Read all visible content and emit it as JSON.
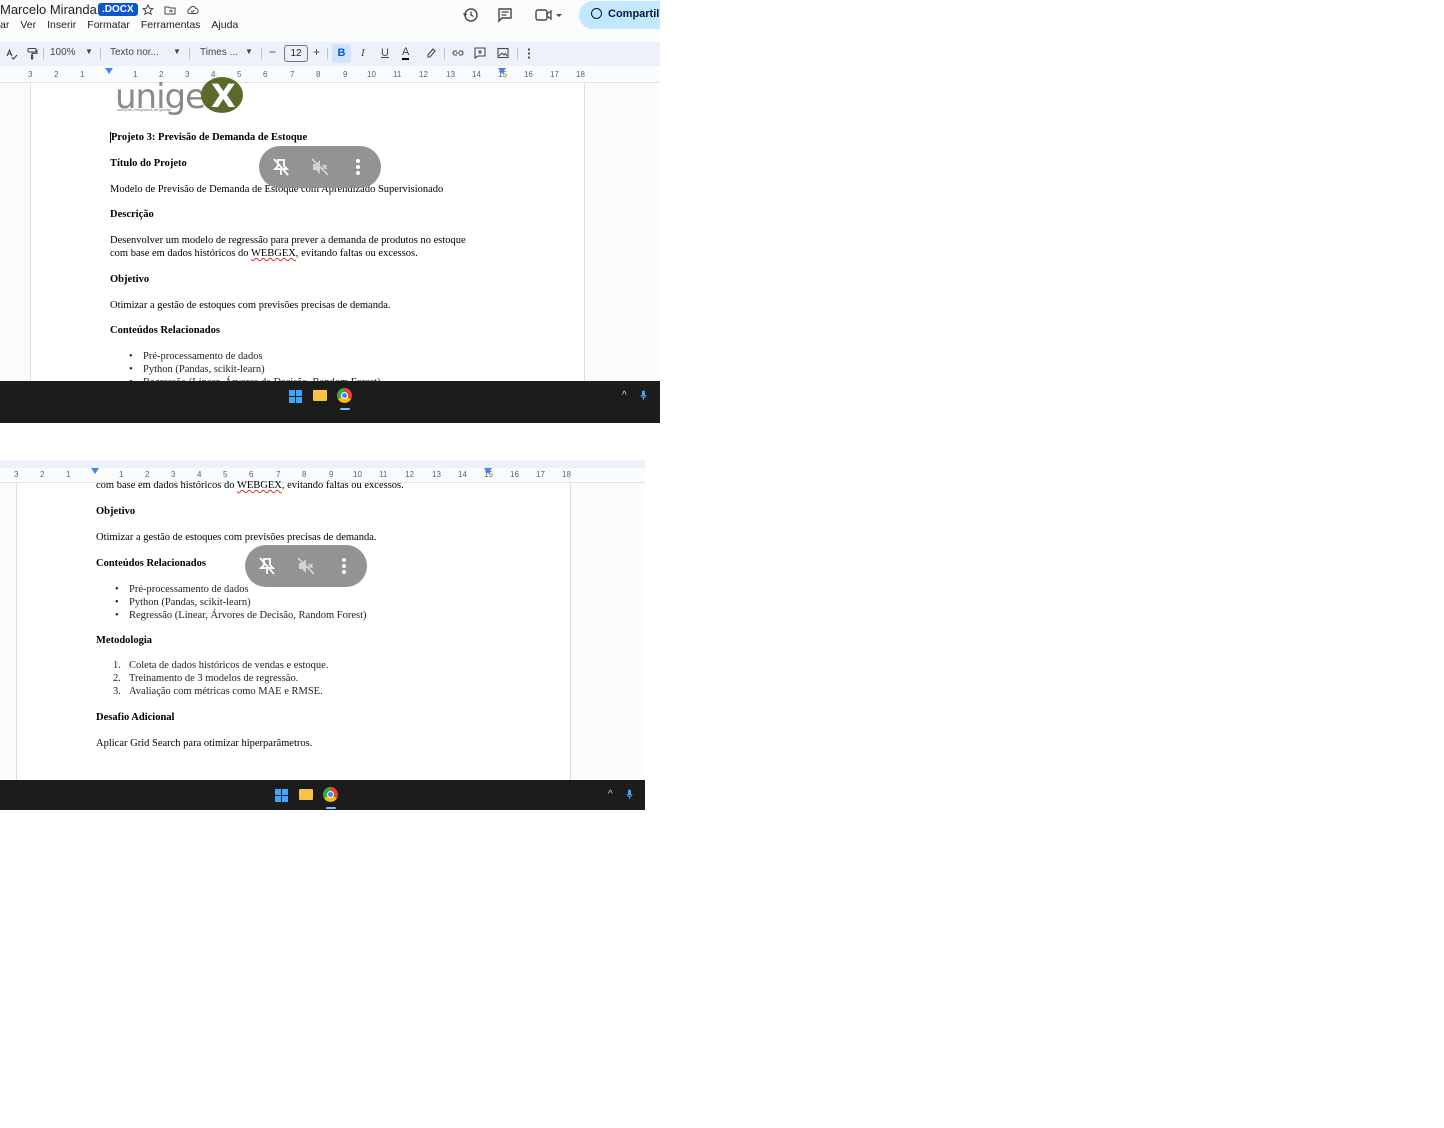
{
  "header": {
    "doc_title": "Marcelo Miranda",
    "badge": ".DOCX",
    "menu": [
      "ar",
      "Ver",
      "Inserir",
      "Formatar",
      "Ferramentas",
      "Ajuda"
    ],
    "share_label": "Compartilh"
  },
  "toolbar": {
    "zoom": "100%",
    "style": "Texto nor...",
    "font": "Times ...",
    "font_size": "12",
    "bold": "B",
    "italic": "I",
    "underline": "U",
    "text_color": "A",
    "minus": "−",
    "plus": "+"
  },
  "ruler": {
    "top": [
      "3",
      "2",
      "1",
      "1",
      "2",
      "3",
      "4",
      "5",
      "6",
      "7",
      "8",
      "9",
      "10",
      "11",
      "12",
      "13",
      "14",
      "15",
      "16",
      "17",
      "18"
    ],
    "bottom": [
      "3",
      "2",
      "1",
      "1",
      "2",
      "3",
      "4",
      "5",
      "6",
      "7",
      "8",
      "9",
      "10",
      "11",
      "12",
      "13",
      "14",
      "15",
      "16",
      "17",
      "18"
    ]
  },
  "logo": {
    "word": "unige",
    "x": "X",
    "tagline": "soluções integradas de gestão"
  },
  "doc": {
    "project_title": "Projeto 3: Previsão de Demanda de Estoque",
    "h_titulo": "Título do Projeto",
    "titulo": "Modelo de Previsão de Demanda de Estoque com Aprendizado Supervisionado",
    "h_descricao": "Descrição",
    "descricao_1": "Desenvolver um modelo de regressão para prever a demanda de produtos no estoque",
    "descricao_2a": "com base em dados históricos do ",
    "descricao_2b": "WEBGEX",
    "descricao_2c": ", evitando faltas ou excessos.",
    "h_objetivo": "Objetivo",
    "objetivo": "Otimizar a gestão de estoques com previsões precisas de demanda.",
    "h_conteudos": "Conteúdos Relacionados",
    "conteudos": [
      "Pré-processamento de dados",
      "Python (Pandas, scikit-learn)",
      "Regressão (Linear, Árvores de Decisão, Random Forest)"
    ],
    "h_metodologia": "Metodologia",
    "metodologia": [
      "Coleta de dados históricos de vendas e estoque.",
      "Treinamento de 3 modelos de regressão.",
      "Avaliação com métricas como MAE e RMSE."
    ],
    "metodologia_nums": [
      "1.",
      "2.",
      "3."
    ],
    "h_desafio": "Desafio Adicional",
    "desafio": "Aplicar Grid Search para otimizar hiperparâmetros.",
    "bullet": "•"
  },
  "tray": {
    "caret": "^"
  },
  "colors": {
    "accent": "#0b57d0",
    "share_bg": "#c2e7ff",
    "taskbar": "#1c1c1c",
    "toolbar_bg": "#edf2fa"
  }
}
